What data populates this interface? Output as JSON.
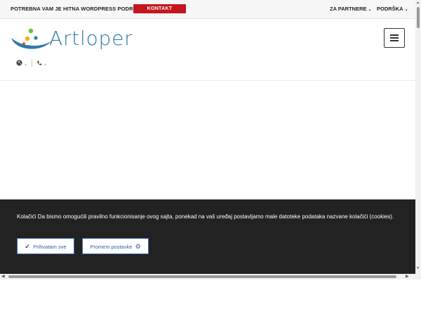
{
  "topbar": {
    "promo": "POTREBNA VAM JE HITNA WORDPRESS PODRŠKA?",
    "contact_button": "KONTAKT",
    "menu": [
      {
        "label": "ZA PARTNERE"
      },
      {
        "label": "PODRŠKA"
      }
    ],
    "accent_color": "#c4161c"
  },
  "header": {
    "logo_text": "Artloper",
    "logo_color": "#2e79a8",
    "icons": [
      "globe-icon",
      "phone-icon",
      "hamburger-menu-icon"
    ]
  },
  "cookie_banner": {
    "message": "Kolačići Da bismo omogućili pravilno funkcionisanje ovog sajta, ponekad na vaš uređaj postavljamo male datoteke podataka nazvane kolačići (cookies).",
    "accept_label": "Prihvatam sve",
    "settings_label": "Promeni postavke",
    "background": "#222222",
    "button_color": "#2f5fa7"
  }
}
